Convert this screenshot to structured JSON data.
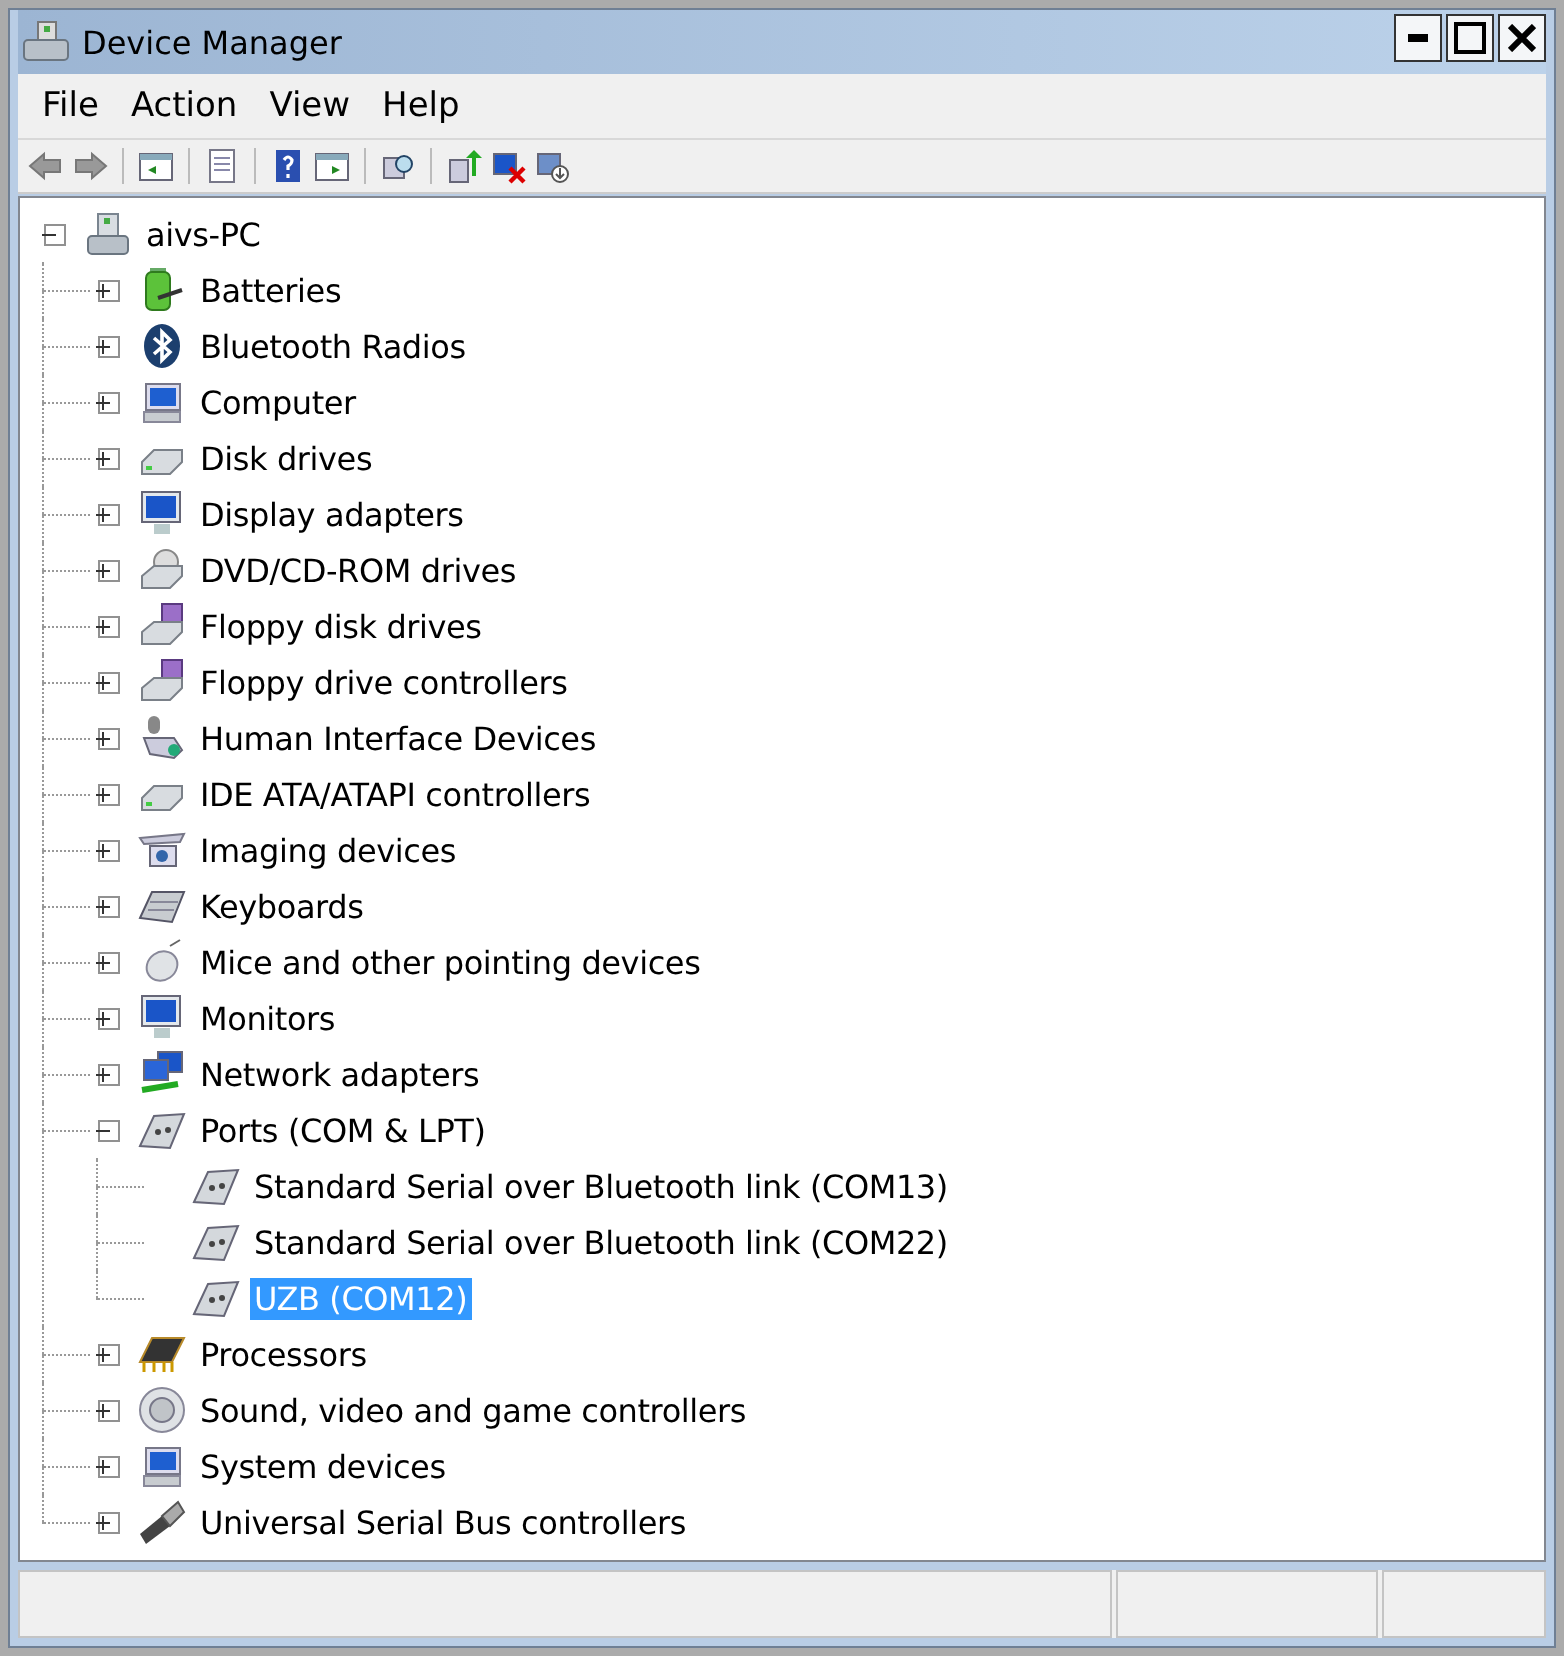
{
  "window": {
    "title": "Device Manager"
  },
  "menu": [
    "File",
    "Action",
    "View",
    "Help"
  ],
  "tree": {
    "label": "aivs-PC",
    "expanded": true,
    "selected": false,
    "children": [
      {
        "label": "Batteries",
        "expanded": false,
        "selected": false
      },
      {
        "label": "Bluetooth Radios",
        "expanded": false,
        "selected": false
      },
      {
        "label": "Computer",
        "expanded": false,
        "selected": false
      },
      {
        "label": "Disk drives",
        "expanded": false,
        "selected": false
      },
      {
        "label": "Display adapters",
        "expanded": false,
        "selected": false
      },
      {
        "label": "DVD/CD-ROM drives",
        "expanded": false,
        "selected": false
      },
      {
        "label": "Floppy disk drives",
        "expanded": false,
        "selected": false
      },
      {
        "label": "Floppy drive controllers",
        "expanded": false,
        "selected": false
      },
      {
        "label": "Human Interface Devices",
        "expanded": false,
        "selected": false
      },
      {
        "label": "IDE ATA/ATAPI controllers",
        "expanded": false,
        "selected": false
      },
      {
        "label": "Imaging devices",
        "expanded": false,
        "selected": false
      },
      {
        "label": "Keyboards",
        "expanded": false,
        "selected": false
      },
      {
        "label": "Mice and other pointing devices",
        "expanded": false,
        "selected": false
      },
      {
        "label": "Monitors",
        "expanded": false,
        "selected": false
      },
      {
        "label": "Network adapters",
        "expanded": false,
        "selected": false
      },
      {
        "label": "Ports (COM & LPT)",
        "expanded": true,
        "selected": false,
        "children": [
          {
            "label": "Standard Serial over Bluetooth link (COM13)",
            "selected": false
          },
          {
            "label": "Standard Serial over Bluetooth link (COM22)",
            "selected": false
          },
          {
            "label": "UZB (COM12)",
            "selected": true
          }
        ]
      },
      {
        "label": "Processors",
        "expanded": false,
        "selected": false
      },
      {
        "label": "Sound, video and game controllers",
        "expanded": false,
        "selected": false
      },
      {
        "label": "System devices",
        "expanded": false,
        "selected": false
      },
      {
        "label": "Universal Serial Bus controllers",
        "expanded": false,
        "selected": false
      }
    ]
  }
}
